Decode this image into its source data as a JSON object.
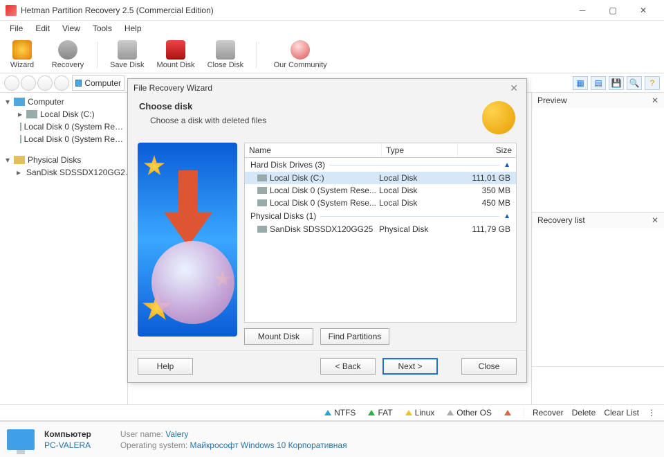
{
  "titlebar": {
    "title": "Hetman Partition Recovery 2.5 (Commercial Edition)"
  },
  "menu": [
    "File",
    "Edit",
    "View",
    "Tools",
    "Help"
  ],
  "toolbar": {
    "wizard": "Wizard",
    "recovery": "Recovery",
    "save_disk": "Save Disk",
    "mount_disk": "Mount Disk",
    "close_disk": "Close Disk",
    "community": "Our Community"
  },
  "addressbar": {
    "label": "Computer"
  },
  "tree": {
    "computer": "Computer",
    "local_c": "Local Disk (C:)",
    "local_0a": "Local Disk 0 (System Re…",
    "local_0b": "Local Disk 0 (System Re…",
    "phys": "Physical Disks",
    "sandisk": "SanDisk SDSSDX120GG2…"
  },
  "panels": {
    "preview": "Preview",
    "recovery_list": "Recovery list"
  },
  "legend": {
    "ntfs": "NTFS",
    "fat": "FAT",
    "linux": "Linux",
    "other": "Other OS",
    "recover": "Recover",
    "delete": "Delete",
    "clear": "Clear List"
  },
  "status": {
    "computer": "Компьютер",
    "pcname": "PC-VALERA",
    "user_lbl": "User name:",
    "user_val": "Valery",
    "os_lbl": "Operating system:",
    "os_val": "Майкрософт Windows 10 Корпоративная"
  },
  "wizard": {
    "title": "File Recovery Wizard",
    "heading": "Choose disk",
    "sub": "Choose a disk with deleted files",
    "cols": {
      "name": "Name",
      "type": "Type",
      "size": "Size"
    },
    "grp_hdd": "Hard Disk Drives (3)",
    "grp_phys": "Physical Disks (1)",
    "rows": [
      {
        "name": "Local Disk (C:)",
        "type": "Local Disk",
        "size": "111,01 GB",
        "sel": true
      },
      {
        "name": "Local Disk 0 (System Rese...",
        "type": "Local Disk",
        "size": "350 MB"
      },
      {
        "name": "Local Disk 0 (System Rese...",
        "type": "Local Disk",
        "size": "450 MB"
      }
    ],
    "prow": {
      "name": "SanDisk SDSSDX120GG25",
      "type": "Physical Disk",
      "size": "111,79 GB"
    },
    "btn_mount": "Mount Disk",
    "btn_find": "Find Partitions",
    "btn_help": "Help",
    "btn_back": "< Back",
    "btn_next": "Next >",
    "btn_close": "Close"
  }
}
